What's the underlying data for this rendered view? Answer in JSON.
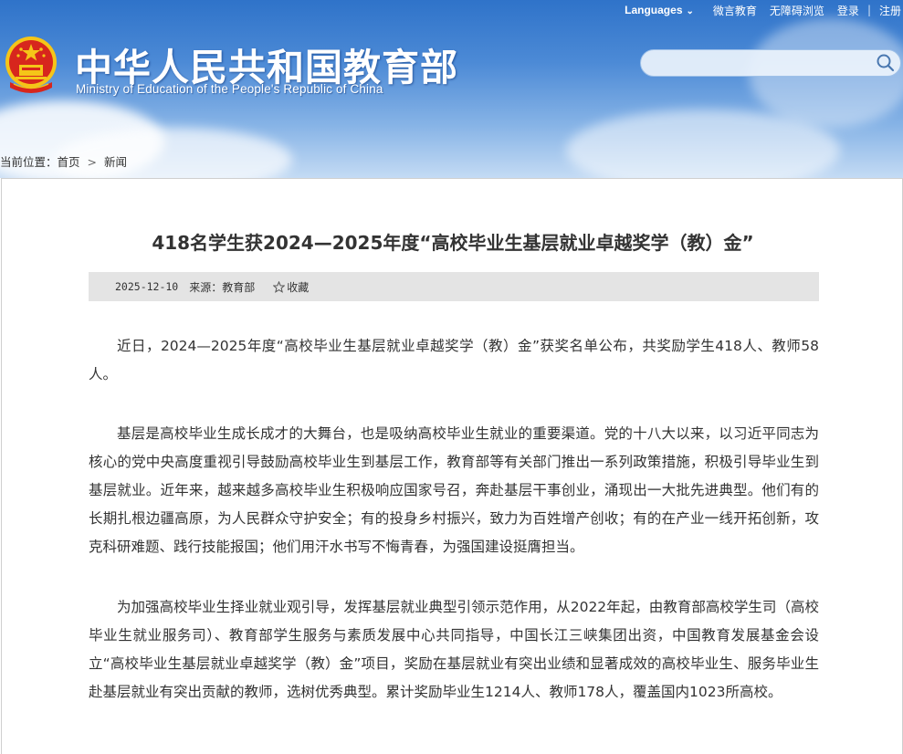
{
  "top_nav": {
    "languages": "Languages",
    "weibo": "微言教育",
    "accessibility": "无障碍浏览",
    "login": "登录",
    "separator": "|",
    "register": "注册"
  },
  "header": {
    "title_cn": "中华人民共和国教育部",
    "title_en": "Ministry of Education of the People's Republic of China"
  },
  "search": {
    "placeholder": ""
  },
  "breadcrumb": {
    "label": "当前位置：",
    "home": "首页",
    "separator": ">",
    "current": "新闻"
  },
  "article": {
    "title": "418名学生获2024—2025年度“高校毕业生基层就业卓越奖学（教）金”",
    "date": "2025-12-10",
    "source": "来源：教育部",
    "favorite": "收藏",
    "paragraphs": [
      "近日，2024—2025年度“高校毕业生基层就业卓越奖学（教）金”获奖名单公布，共奖励学生418人、教师58人。",
      "基层是高校毕业生成长成才的大舞台，也是吸纳高校毕业生就业的重要渠道。党的十八大以来，以习近平同志为核心的党中央高度重视引导鼓励高校毕业生到基层工作，教育部等有关部门推出一系列政策措施，积极引导毕业生到基层就业。近年来，越来越多高校毕业生积极响应国家号召，奔赴基层干事创业，涌现出一大批先进典型。他们有的长期扎根边疆高原，为人民群众守护安全；有的投身乡村振兴，致力为百姓增产创收；有的在产业一线开拓创新，攻克科研难题、践行技能报国；他们用汗水书写不悔青春，为强国建设挺膺担当。",
      "为加强高校毕业生择业就业观引导，发挥基层就业典型引领示范作用，从2022年起，由教育部高校学生司（高校毕业生就业服务司）、教育部学生服务与素质发展中心共同指导，中国长江三峡集团出资，中国教育发展基金会设立“高校毕业生基层就业卓越奖学（教）金”项目，奖励在基层就业有突出业绩和显著成效的高校毕业生、服务毕业生赴基层就业有突出贡献的教师，选树优秀典型。累计奖励毕业生1214人、教师178人，覆盖国内1023所高校。"
    ]
  },
  "colors": {
    "header_blue": "#2f73c9",
    "meta_bar": "#e4e4e4",
    "emblem_red": "#d7261d",
    "emblem_gold": "#f5c518"
  },
  "icons": [
    "emblem-icon",
    "chevron-down-icon",
    "search-icon",
    "star-icon"
  ]
}
